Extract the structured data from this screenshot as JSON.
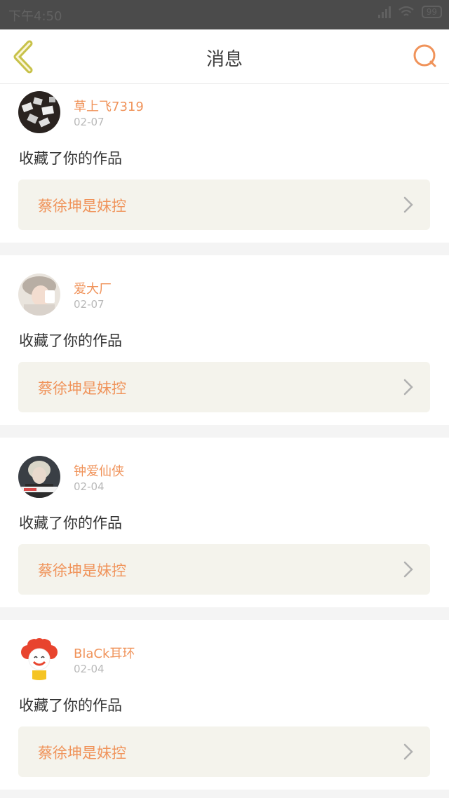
{
  "status_bar": {
    "time": "下午4:50",
    "battery": "99"
  },
  "nav": {
    "title": "消息",
    "back_icon": "chevron-left-icon",
    "search_icon": "search-icon"
  },
  "colors": {
    "accent": "#f0935a",
    "card_link_bg": "#f4f3ec",
    "page_bg": "#f4f4f4",
    "back_icon": "#c8c24a"
  },
  "notifications": [
    {
      "username": "草上飞7319",
      "date": "02-07",
      "action": "收藏了你的作品",
      "work_title": "蔡徐坤是妹控"
    },
    {
      "username": "爱大厂",
      "date": "02-07",
      "action": "收藏了你的作品",
      "work_title": "蔡徐坤是妹控"
    },
    {
      "username": "钟爱仙侠",
      "date": "02-04",
      "action": "收藏了你的作品",
      "work_title": "蔡徐坤是妹控"
    },
    {
      "username": "BlaCk耳环",
      "date": "02-04",
      "action": "收藏了你的作品",
      "work_title": "蔡徐坤是妹控"
    }
  ]
}
